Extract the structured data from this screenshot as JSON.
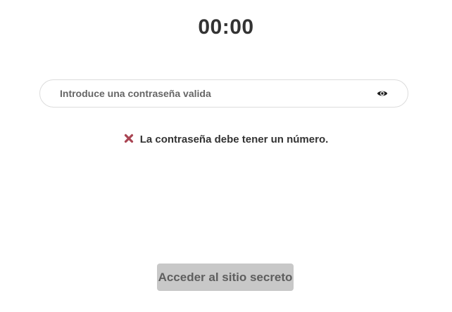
{
  "timer": {
    "value": "00:00"
  },
  "password": {
    "placeholder": "Introduce una contraseña valida",
    "value": "",
    "toggle_icon": "eye-icon"
  },
  "validation": {
    "icon": "close-x-icon",
    "icon_color": "#a94452",
    "message": "La contraseña debe tener un número."
  },
  "submit": {
    "label": "Acceder al sitio secreto",
    "state": "disabled",
    "background": "#c8c8c8"
  }
}
